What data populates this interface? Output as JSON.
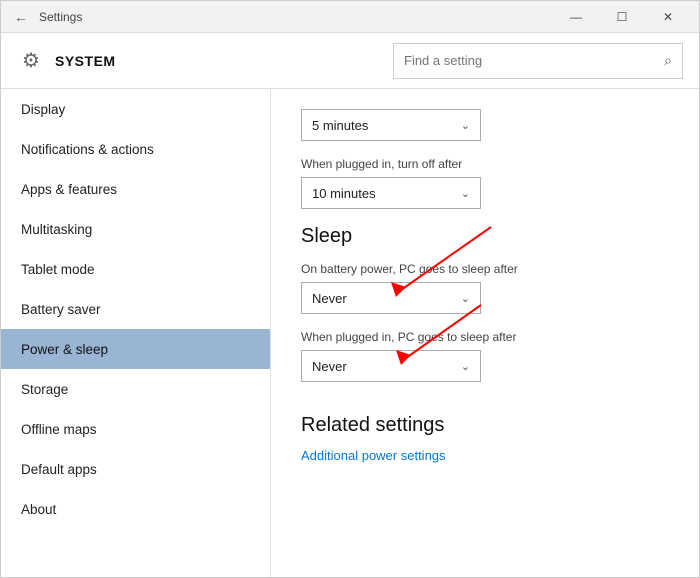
{
  "window": {
    "title": "Settings",
    "controls": {
      "minimize": "—",
      "maximize": "☐",
      "close": "✕"
    }
  },
  "header": {
    "icon": "⚙",
    "title": "SYSTEM",
    "search_placeholder": "Find a setting",
    "search_icon": "🔍"
  },
  "sidebar": {
    "items": [
      {
        "label": "Display",
        "active": false
      },
      {
        "label": "Notifications & actions",
        "active": false
      },
      {
        "label": "Apps & features",
        "active": false
      },
      {
        "label": "Multitasking",
        "active": false
      },
      {
        "label": "Tablet mode",
        "active": false
      },
      {
        "label": "Battery saver",
        "active": false
      },
      {
        "label": "Power & sleep",
        "active": true
      },
      {
        "label": "Storage",
        "active": false
      },
      {
        "label": "Offline maps",
        "active": false
      },
      {
        "label": "Default apps",
        "active": false
      },
      {
        "label": "About",
        "active": false
      }
    ]
  },
  "main": {
    "plugged_label": "When plugged in, turn off after",
    "plugged_value": "10 minutes",
    "sleep_section_title": "Sleep",
    "battery_sleep_label": "On battery power, PC goes to sleep after",
    "battery_sleep_value": "Never",
    "plugged_sleep_label": "When plugged in, PC goes to sleep after",
    "plugged_sleep_value": "Never",
    "related_title": "Related settings",
    "related_link": "Additional power settings",
    "top_dropdown_value": "5 minutes"
  }
}
